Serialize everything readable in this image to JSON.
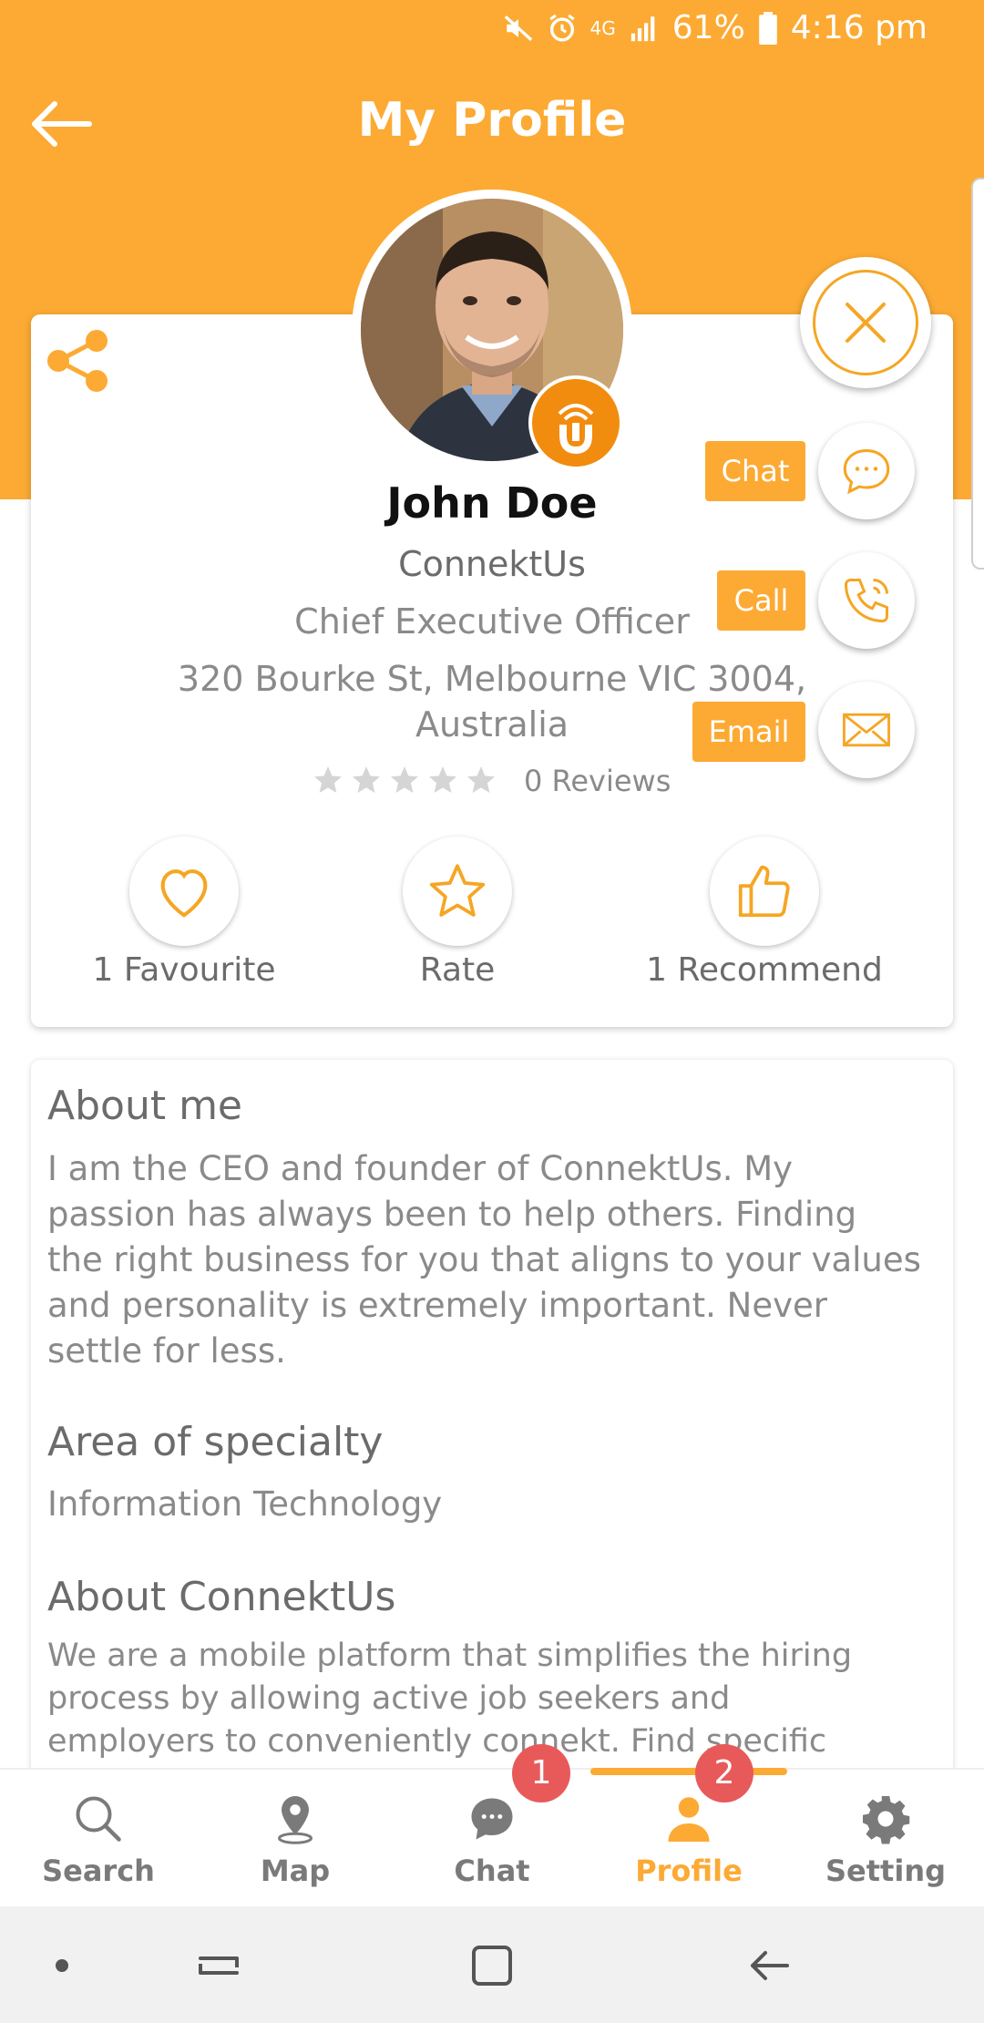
{
  "colors": {
    "accent": "#FCAA33",
    "badge": "#E85A5A",
    "text_muted": "#8A8A8A"
  },
  "status_bar": {
    "battery": "61%",
    "time": "4:16 pm",
    "network": "4G"
  },
  "header": {
    "title": "My Profile",
    "back_icon": "arrow-left-icon"
  },
  "profile": {
    "name": "John Doe",
    "company": "ConnektUs",
    "position": "Chief Executive Officer",
    "address": "320 Bourke St, Melbourne VIC 3004, Australia",
    "rating": 0,
    "rating_max": 5,
    "reviews_label": "0 Reviews"
  },
  "actions": [
    {
      "label": "1 Favourite",
      "icon": "heart-icon"
    },
    {
      "label": "Rate",
      "icon": "star-icon"
    },
    {
      "label": "1 Recommend",
      "icon": "thumbs-up-icon"
    }
  ],
  "contact_menu": {
    "close_icon": "close-icon",
    "chat_label": "Chat",
    "call_label": "Call",
    "email_label": "Email"
  },
  "about": {
    "about_me_title": "About me",
    "about_me_text": "I am the CEO and founder of ConnektUs. My passion has always been to help others. Finding the right business for you that aligns to your values and personality is extremely important. Never settle for less.",
    "specialty_title": "Area of specialty",
    "specialty_text": "Information Technology",
    "company_title": "About ConnektUs",
    "company_text": "We are a mobile platform that simplifies the hiring process by allowing active job seekers and employers to conveniently connekt. Find specific"
  },
  "bottom_nav": {
    "items": [
      {
        "label": "Search",
        "icon": "search-icon"
      },
      {
        "label": "Map",
        "icon": "map-pin-icon"
      },
      {
        "label": "Chat",
        "icon": "chat-icon"
      },
      {
        "label": "Profile",
        "icon": "person-icon"
      },
      {
        "label": "Setting",
        "icon": "gear-icon"
      }
    ],
    "active": "Profile",
    "chat_badge": "1",
    "profile_badge": "2"
  }
}
